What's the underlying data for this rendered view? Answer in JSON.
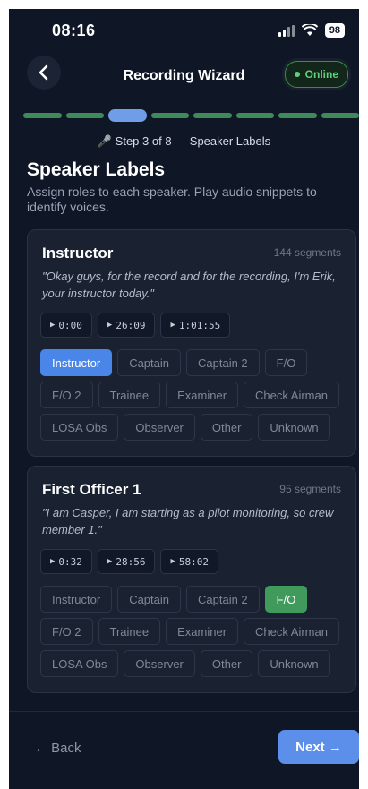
{
  "status_bar": {
    "time": "08:16",
    "battery": "98"
  },
  "nav": {
    "back_icon": "chevron-left-icon",
    "title": "Recording Wizard",
    "online_label": "Online"
  },
  "progress": {
    "total_steps": 8,
    "current_step": 3,
    "done_color": "#3f8a5b",
    "current_color": "#6f9de8"
  },
  "step": {
    "label": "🎤 Step 3 of 8 — Speaker Labels"
  },
  "page": {
    "title": "Speaker Labels",
    "subtitle": "Assign roles to each speaker. Play audio snippets to identify voices."
  },
  "speakers": [
    {
      "name": "Instructor",
      "segments": "144 segments",
      "quote": "\"Okay guys, for the record and for the recording, I'm Erik, your instructor today.\"",
      "snippets": [
        "0:00",
        "26:09",
        "1:01:55"
      ],
      "selected_role": "Instructor",
      "selected_color": "#4a86e8"
    },
    {
      "name": "First Officer 1",
      "segments": "95 segments",
      "quote": "\"I am Casper, I am starting as a pilot monitoring, so crew member 1.\"",
      "snippets": [
        "0:32",
        "28:56",
        "58:02"
      ],
      "selected_role": "F/O",
      "selected_color": "#3f9a5c"
    }
  ],
  "roles": [
    "Instructor",
    "Captain",
    "Captain 2",
    "F/O",
    "F/O 2",
    "Trainee",
    "Examiner",
    "Check Airman",
    "LOSA Obs",
    "Observer",
    "Other",
    "Unknown"
  ],
  "footer": {
    "back_label": "← Back",
    "next_label": "Next →"
  }
}
